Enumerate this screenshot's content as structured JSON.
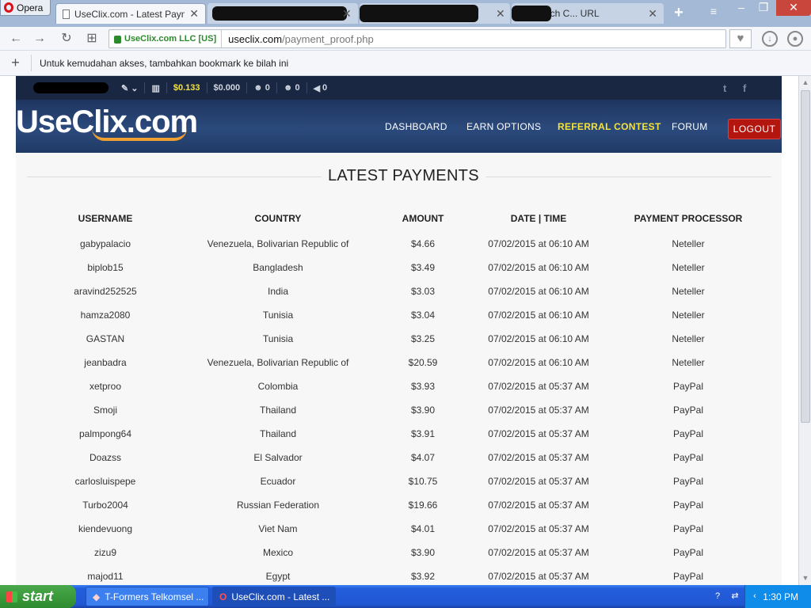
{
  "browser": {
    "app_label": "Opera",
    "tabs": [
      {
        "label": "UseClix.com - Latest Paymen",
        "active": true
      },
      {
        "label": "",
        "active": false
      },
      {
        "label": "",
        "active": false
      },
      {
        "label": "arch C...  URL",
        "active": false
      }
    ],
    "security_label": "UseClix.com LLC [US]",
    "url_host": "useclix.com",
    "url_path": "/payment_proof.php",
    "bookmark_hint": "Untuk kemudahan akses, tambahkan bookmark ke bilah ini"
  },
  "site": {
    "stats": {
      "balance_1": "$0.133",
      "balance_2": "$0.000",
      "stat_a": "0",
      "stat_b": "0",
      "stat_c": "0"
    },
    "logo_text": "UseClix.com",
    "menu": {
      "dashboard": "DASHBOARD",
      "earn_options": "EARN OPTIONS",
      "referral_contest": "REFERRAL CONTEST",
      "forum": "FORUM",
      "logout": "LOGOUT"
    },
    "heading": "LATEST PAYMENTS",
    "table": {
      "headers": [
        "USERNAME",
        "COUNTRY",
        "AMOUNT",
        "DATE | TIME",
        "PAYMENT PROCESSOR"
      ],
      "rows": [
        [
          "gabypalacio",
          "Venezuela, Bolivarian Republic of",
          "$4.66",
          "07/02/2015 at 06:10 AM",
          "Neteller"
        ],
        [
          "biplob15",
          "Bangladesh",
          "$3.49",
          "07/02/2015 at 06:10 AM",
          "Neteller"
        ],
        [
          "aravind252525",
          "India",
          "$3.03",
          "07/02/2015 at 06:10 AM",
          "Neteller"
        ],
        [
          "hamza2080",
          "Tunisia",
          "$3.04",
          "07/02/2015 at 06:10 AM",
          "Neteller"
        ],
        [
          "GASTAN",
          "Tunisia",
          "$3.25",
          "07/02/2015 at 06:10 AM",
          "Neteller"
        ],
        [
          "jeanbadra",
          "Venezuela, Bolivarian Republic of",
          "$20.59",
          "07/02/2015 at 06:10 AM",
          "Neteller"
        ],
        [
          "xetproo",
          "Colombia",
          "$3.93",
          "07/02/2015 at 05:37 AM",
          "PayPal"
        ],
        [
          "Smoji",
          "Thailand",
          "$3.90",
          "07/02/2015 at 05:37 AM",
          "PayPal"
        ],
        [
          "palmpong64",
          "Thailand",
          "$3.91",
          "07/02/2015 at 05:37 AM",
          "PayPal"
        ],
        [
          "Doazss",
          "El Salvador",
          "$4.07",
          "07/02/2015 at 05:37 AM",
          "PayPal"
        ],
        [
          "carlosluispepe",
          "Ecuador",
          "$10.75",
          "07/02/2015 at 05:37 AM",
          "PayPal"
        ],
        [
          "Turbo2004",
          "Russian Federation",
          "$19.66",
          "07/02/2015 at 05:37 AM",
          "PayPal"
        ],
        [
          "kiendevuong",
          "Viet Nam",
          "$4.01",
          "07/02/2015 at 05:37 AM",
          "PayPal"
        ],
        [
          "zizu9",
          "Mexico",
          "$3.90",
          "07/02/2015 at 05:37 AM",
          "PayPal"
        ],
        [
          "majod11",
          "Egypt",
          "$3.92",
          "07/02/2015 at 05:37 AM",
          "PayPal"
        ]
      ]
    }
  },
  "taskbar": {
    "start_label": "start",
    "tasks": [
      "T-Formers Telkomsel ...",
      "UseClix.com - Latest ..."
    ],
    "clock": "1:30 PM"
  }
}
